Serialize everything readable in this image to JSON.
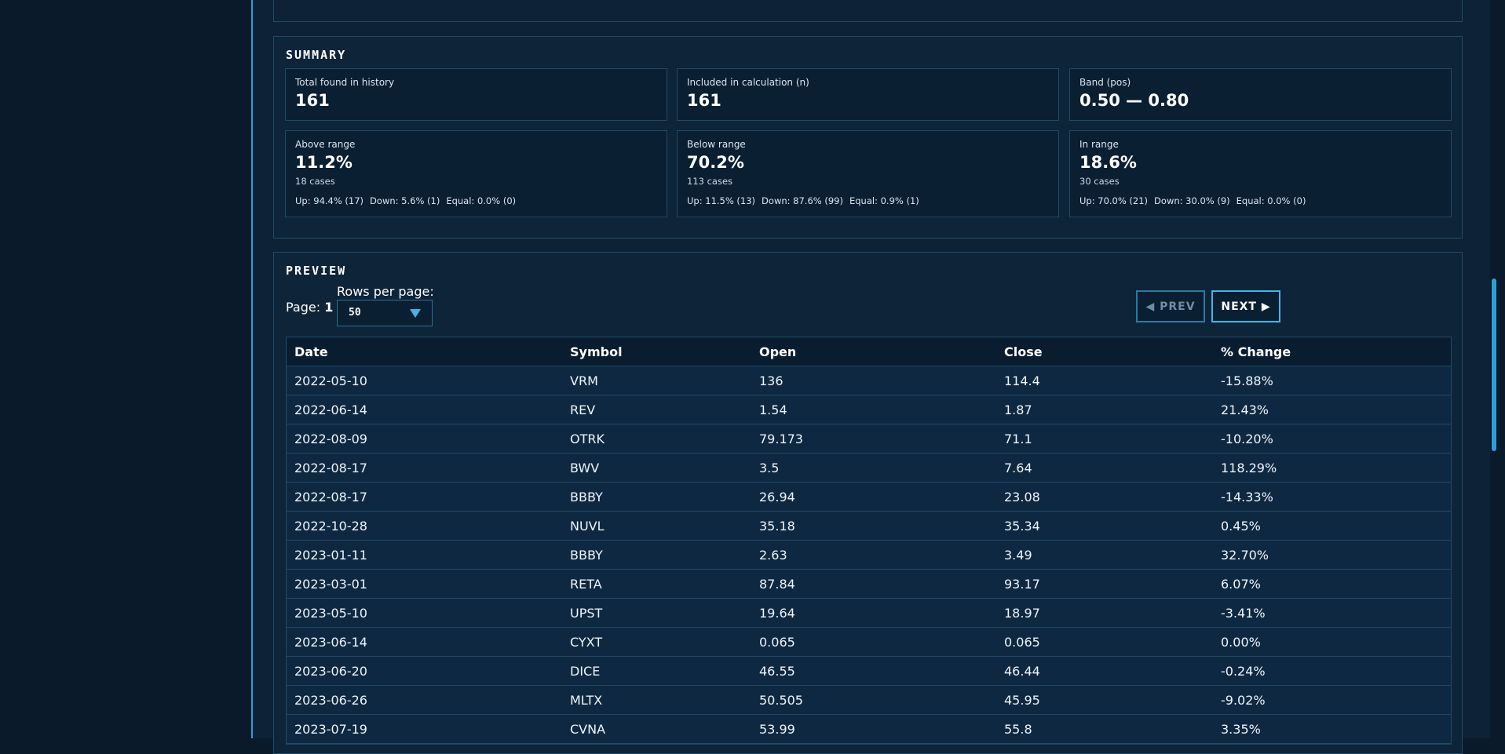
{
  "summary": {
    "title": "Summary",
    "cards": [
      {
        "label": "Total found in history",
        "value": "161"
      },
      {
        "label": "Included in calculation (n)",
        "value": "161"
      },
      {
        "label": "Band (pos)",
        "value": "0.50 — 0.80"
      }
    ],
    "ranges": [
      {
        "label": "Above range",
        "value": "11.2%",
        "cases": "18 cases",
        "up": "Up: 94.4% (17)",
        "down": "Down: 5.6% (1)",
        "equal": "Equal: 0.0% (0)"
      },
      {
        "label": "Below range",
        "value": "70.2%",
        "cases": "113 cases",
        "up": "Up: 11.5% (13)",
        "down": "Down: 87.6% (99)",
        "equal": "Equal: 0.9% (1)"
      },
      {
        "label": "In range",
        "value": "18.6%",
        "cases": "30 cases",
        "up": "Up: 70.0% (21)",
        "down": "Down: 30.0% (9)",
        "equal": "Equal: 0.0% (0)"
      }
    ]
  },
  "preview": {
    "title": "Preview",
    "page_label": "Page:",
    "page_number": "1",
    "rows_per_page_label": "Rows per page:",
    "rows_per_page_value": "50",
    "prev_label": "◀ PREV",
    "next_label": "NEXT ▶",
    "columns": [
      "Date",
      "Symbol",
      "Open",
      "Close",
      "% Change"
    ],
    "rows": [
      [
        "2022-05-10",
        "VRM",
        "136",
        "114.4",
        "-15.88%"
      ],
      [
        "2022-06-14",
        "REV",
        "1.54",
        "1.87",
        "21.43%"
      ],
      [
        "2022-08-09",
        "OTRK",
        "79.173",
        "71.1",
        "-10.20%"
      ],
      [
        "2022-08-17",
        "BWV",
        "3.5",
        "7.64",
        "118.29%"
      ],
      [
        "2022-08-17",
        "BBBY",
        "26.94",
        "23.08",
        "-14.33%"
      ],
      [
        "2022-10-28",
        "NUVL",
        "35.18",
        "35.34",
        "0.45%"
      ],
      [
        "2023-01-11",
        "BBBY",
        "2.63",
        "3.49",
        "32.70%"
      ],
      [
        "2023-03-01",
        "RETA",
        "87.84",
        "93.17",
        "6.07%"
      ],
      [
        "2023-05-10",
        "UPST",
        "19.64",
        "18.97",
        "-3.41%"
      ],
      [
        "2023-06-14",
        "CYXT",
        "0.065",
        "0.065",
        "0.00%"
      ],
      [
        "2023-06-20",
        "DICE",
        "46.55",
        "46.44",
        "-0.24%"
      ],
      [
        "2023-06-26",
        "MLTX",
        "50.505",
        "45.95",
        "-9.02%"
      ],
      [
        "2023-07-19",
        "CVNA",
        "53.99",
        "55.8",
        "3.35%"
      ]
    ]
  }
}
